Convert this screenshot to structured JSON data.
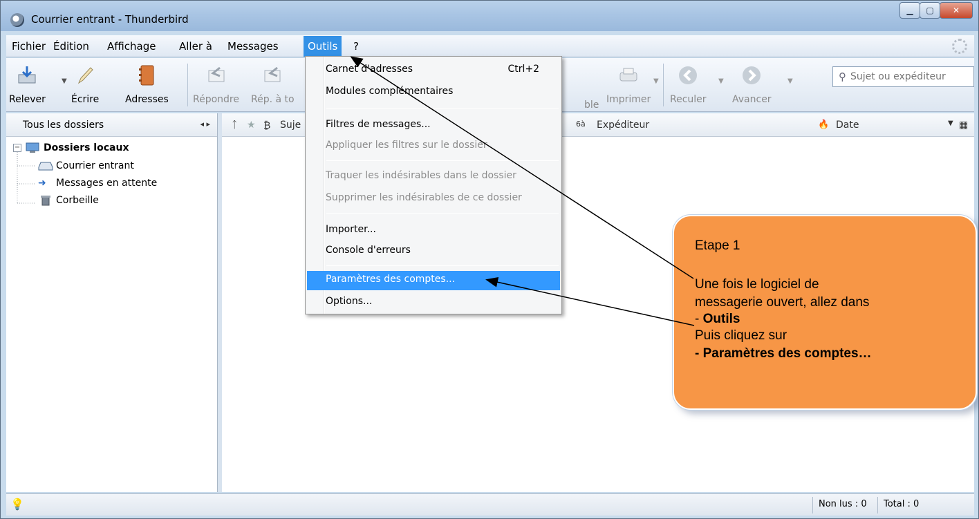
{
  "window": {
    "title": "Courrier entrant - Thunderbird"
  },
  "menubar": {
    "items": [
      "Fichier",
      "Édition",
      "Affichage",
      "Aller à",
      "Messages",
      "Outils",
      "?"
    ]
  },
  "toolbar": {
    "buttons": [
      "Relever",
      "Écrire",
      "Adresses",
      "Répondre",
      "Rép. à to",
      "ble",
      "Imprimer",
      "Reculer",
      "Avancer"
    ],
    "search_placeholder": "Sujet ou expéditeur"
  },
  "folder_pane": {
    "header": "Tous les dossiers",
    "root": "Dossiers locaux",
    "folders": [
      "Courrier entrant",
      "Messages en attente",
      "Corbeille"
    ]
  },
  "thread_pane": {
    "columns": {
      "subject": "Suje",
      "sender": "Expéditeur",
      "date": "Date"
    }
  },
  "outils_menu": {
    "items": [
      {
        "label": "Carnet d'adresses",
        "shortcut": "Ctrl+2",
        "enabled": true
      },
      {
        "label": "Modules complémentaires",
        "enabled": true
      },
      {
        "label": "Filtres de messages...",
        "enabled": true
      },
      {
        "label": "Appliquer les filtres sur le dossier",
        "enabled": false
      },
      {
        "label": "Traquer les indésirables dans le dossier",
        "enabled": false
      },
      {
        "label": "Supprimer les indésirables de ce dossier",
        "enabled": false
      },
      {
        "label": "Importer...",
        "enabled": true
      },
      {
        "label": "Console d'erreurs",
        "enabled": true
      },
      {
        "label": "Paramètres des comptes...",
        "enabled": true,
        "highlighted": true
      },
      {
        "label": "Options...",
        "enabled": true
      }
    ]
  },
  "statusbar": {
    "unread": "Non lus : 0",
    "total": "Total : 0"
  },
  "callout": {
    "title": "Etape 1",
    "line1": "Une fois le logiciel de",
    "line2": "messagerie ouvert, allez dans",
    "line3_prefix": "- ",
    "line3_bold": "Outils",
    "line4": "Puis cliquez sur",
    "line5": "- Paramètres des comptes…"
  },
  "colors": {
    "accent": "#3399ff",
    "callout": "#f79646",
    "frame": "#c9dced"
  }
}
